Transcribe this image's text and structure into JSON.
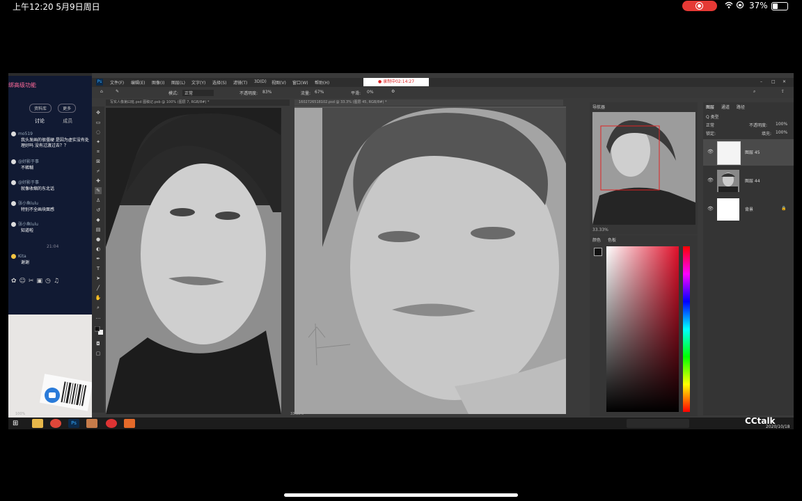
{
  "status_bar": {
    "time": "上午12:20   5月9日周日",
    "battery_pct": "37%",
    "icons": "wifi-icon lock-rotation-icon"
  },
  "chat": {
    "header": "绑高级功能",
    "buttons": [
      "资料库",
      "更多"
    ],
    "tabs": [
      "讨论",
      "成员"
    ],
    "messages": [
      {
        "user": "mo519",
        "text": "我头发画的很僵硬 是因为虚实没有处理好吗 没有过渡过去？？"
      },
      {
        "user": "@好影于事",
        "text": "不稀糊"
      },
      {
        "user": "@好影于事",
        "text": "就像收缩的东北话"
      },
      {
        "user": "张小鱼lulu",
        "text": "特别不全画块面感"
      },
      {
        "user": "张小鱼lulu",
        "text": "知道啦"
      },
      {
        "user": "Kita",
        "text": "谢谢"
      }
    ],
    "timestamp": "21:04"
  },
  "photoshop": {
    "menus": [
      "文件(F)",
      "编辑(E)",
      "图像(I)",
      "图层(L)",
      "文字(Y)",
      "选择(S)",
      "滤镜(T)",
      "3D(D)",
      "视图(V)",
      "窗口(W)",
      "帮助(H)"
    ],
    "timer": "● 录制中02:14:27",
    "options": {
      "mode_label": "模式:",
      "mode_value": "正常",
      "opacity_label": "不透明度:",
      "opacity_value": "83%",
      "flow_label": "流量:",
      "flow_value": "67%",
      "smooth_label": "平滑:",
      "smooth_value": "0%"
    },
    "doc_tabs": [
      "写实人像第曰班.psd 图稿记.psb @ 100% (图层 7, RGB/8#) *",
      "1602726518102.psd @ 33.3% (图层 45, RGB/8#) *"
    ],
    "navigator": {
      "title": "导航器",
      "zoom": "33.33%"
    },
    "color": {
      "tabs": [
        "颜色",
        "色板"
      ]
    },
    "layers": {
      "tabs": [
        "图层",
        "通道",
        "路径"
      ],
      "kind_label": "Q 类型",
      "blend_mode": "正常",
      "opacity_label": "不透明度:",
      "opacity_value": "100%",
      "lock_label": "锁定:",
      "fill_label": "填充:",
      "fill_value": "100%",
      "items": [
        {
          "name": "图层 45"
        },
        {
          "name": "图层 44"
        },
        {
          "name": "背景"
        }
      ]
    },
    "status_left": "100%",
    "status_right": "33.33%"
  },
  "watermark": {
    "brand": "CCtalk",
    "date": "2020/10/18"
  }
}
